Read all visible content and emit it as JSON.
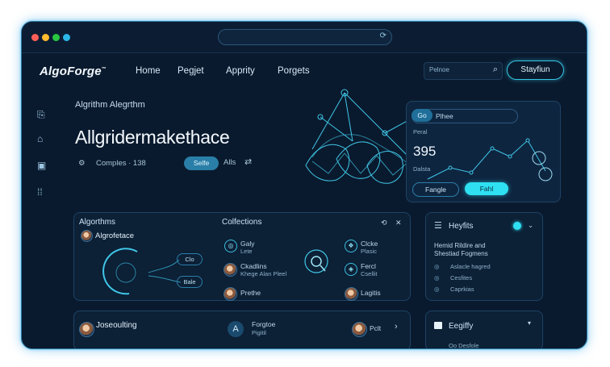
{
  "window": {
    "traffic_lights": [
      "#ff5f57",
      "#febc2e",
      "#28c840",
      "#2bb6e8"
    ]
  },
  "nav": {
    "logo": "AlgoForge",
    "logo_mark": "™",
    "links": [
      "Home",
      "Pegjet",
      "Apprity",
      "Porgets"
    ],
    "search_placeholder": "Pelnoe",
    "cta": "Stayfiun"
  },
  "sidebar": {
    "icons": [
      "clipboard-icon",
      "home-icon",
      "folder-icon",
      "grid-icon"
    ]
  },
  "hero": {
    "kicker": "Algrithm Alegrthm",
    "title": "Allgridermakethace",
    "meta": "Comples · 138",
    "primary_btn": "Selfe",
    "secondary_btn": "Alls"
  },
  "stats_card": {
    "tab_active": "Go",
    "tab_label": "Plhee",
    "label": "Peral",
    "value": "395",
    "sub": "Dalsta",
    "btn_outline": "Fangle",
    "btn_filled": "Fahl"
  },
  "algorithms_card": {
    "title": "Algorthms",
    "item": "Algrofetace",
    "tags": [
      "Clo",
      "Bale"
    ]
  },
  "collections_card": {
    "title": "Colfections",
    "items": [
      {
        "name": "Galy",
        "sub": "Lete"
      },
      {
        "name": "Ckadlins",
        "sub": "Khege Alan Pleel"
      },
      {
        "name": "Prethe",
        "sub": ""
      }
    ],
    "right_items": [
      {
        "name": "Clcke",
        "sub": "Plasic"
      },
      {
        "name": "Fercl",
        "sub": "Csellit"
      },
      {
        "name": "Lagitis",
        "sub": ""
      }
    ]
  },
  "insights_card": {
    "title": "Heyfits",
    "desc": "Hemid Rildire and Shestiad Fogmens",
    "items": [
      "Aslacle hagred",
      "Cesfites",
      "Caprkias"
    ]
  },
  "bottom_card": {
    "item1": "Joseoulting",
    "item2": "Forgtoe",
    "item2_sub": "Pigitil",
    "item3": "Pclt"
  },
  "activity_card": {
    "title": "Eegiffy",
    "item": "Oo Desfole"
  }
}
